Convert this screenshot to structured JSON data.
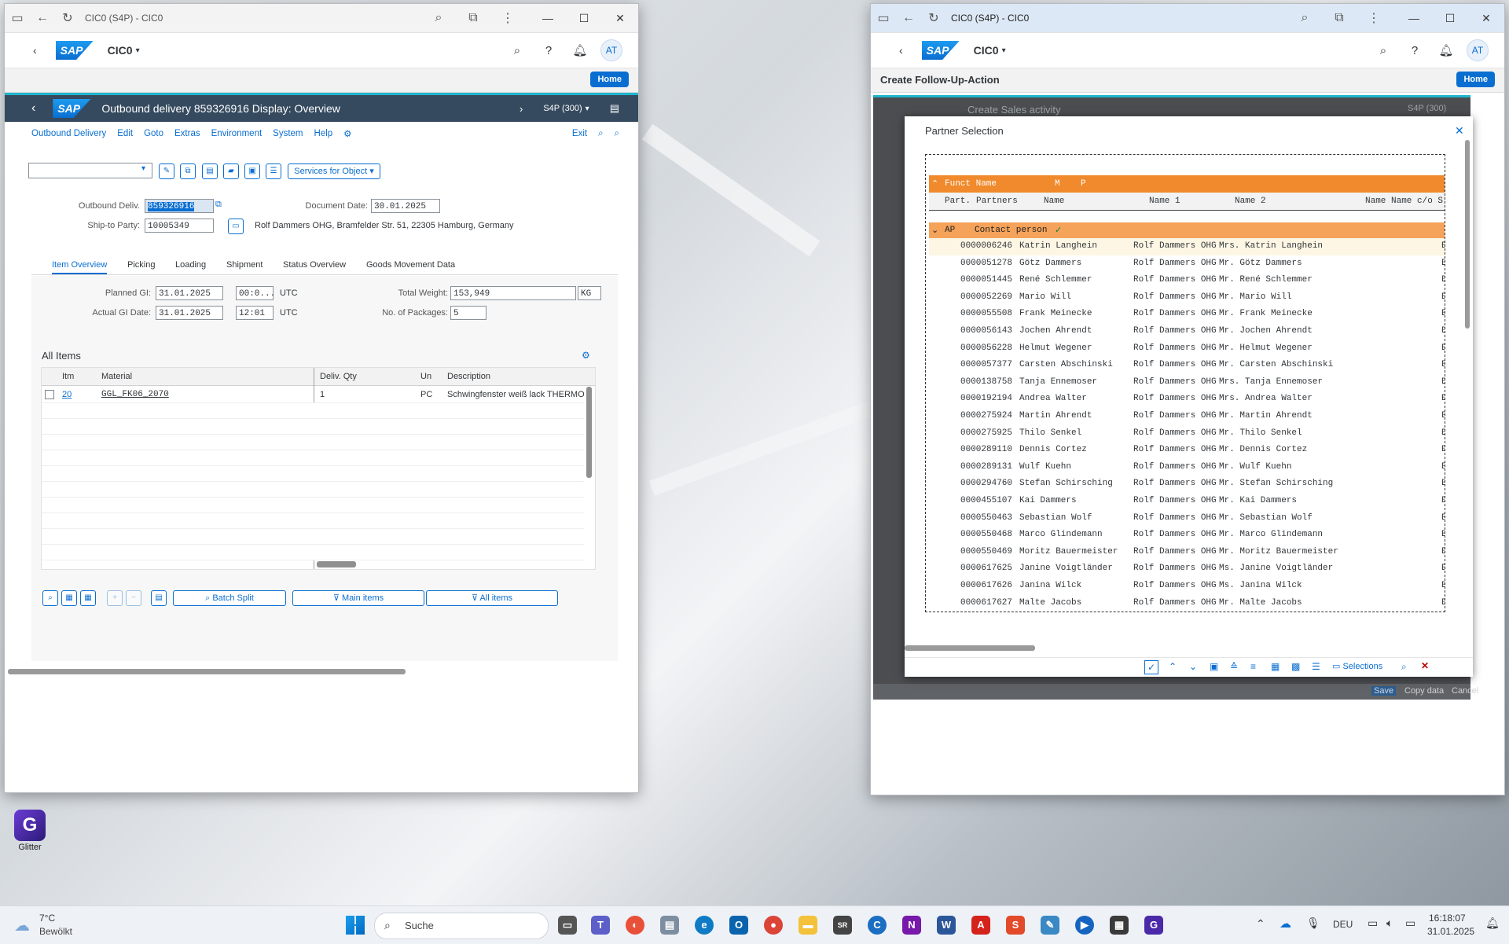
{
  "desktop": {
    "shortcut_label": "Glitter",
    "icons": {
      "shortcut": "glitter-app-icon"
    }
  },
  "left_window": {
    "browser_title": "CIC0 (S4P) - CIC0",
    "shell": {
      "app_name": "CIC0",
      "avatar_initials": "AT",
      "home_label": "Home"
    },
    "transaction_title": "Outbound delivery 859326916 Display: Overview",
    "system_label": "S4P (300)",
    "menu": [
      "Outbound Delivery",
      "Edit",
      "Goto",
      "Extras",
      "Environment",
      "System",
      "Help"
    ],
    "exit_label": "Exit",
    "services_label": "Services for Object",
    "header": {
      "outbound_label": "Outbound Deliv.",
      "outbound_value": "859326916",
      "docdate_label": "Document Date:",
      "docdate_value": "30.01.2025",
      "shipto_label": "Ship-to Party:",
      "shipto_value": "10005349",
      "shipto_address": "Rolf Dammers OHG, Bramfelder Str. 51, 22305 Hamburg, Germany"
    },
    "tabs": [
      "Item Overview",
      "Picking",
      "Loading",
      "Shipment",
      "Status Overview",
      "Goods Movement Data"
    ],
    "overview": {
      "planned_gi_label": "Planned GI:",
      "planned_gi_date": "31.01.2025",
      "planned_gi_time": "00:0...",
      "actual_gi_label": "Actual GI Date:",
      "actual_gi_date": "31.01.2025",
      "actual_gi_time": "12:01",
      "tz": "UTC",
      "total_weight_label": "Total Weight:",
      "total_weight_value": "153,949",
      "weight_unit": "KG",
      "packages_label": "No. of Packages:",
      "packages_value": "5"
    },
    "items_title": "All Items",
    "items_columns": [
      "Itm",
      "Material",
      "Deliv. Qty",
      "Un",
      "Description"
    ],
    "items_rows": [
      {
        "itm": "20",
        "material": "GGL_FK06_2070",
        "qty": "1",
        "unit": "PC",
        "description": "Schwingfenster weiß lack THERMO"
      }
    ],
    "bottom_buttons": {
      "batch_split": "Batch Split",
      "main_items": "Main items",
      "all_items": "All items"
    }
  },
  "right_window": {
    "browser_title": "CIC0 (S4P) - CIC0",
    "shell": {
      "app_name": "CIC0",
      "avatar_initials": "AT",
      "home_label": "Home"
    },
    "page_title": "Create Follow-Up-Action",
    "bg_transaction": "Create Sales activity",
    "bg_system": "S4P (300)",
    "bg_footer": {
      "save": "Save",
      "copy": "Copy data",
      "cancel": "Cancel"
    },
    "dialog": {
      "title": "Partner Selection",
      "group_header": {
        "funct": "Funct Name",
        "m": "M",
        "p": "P"
      },
      "columns": [
        "Part.",
        "Partners",
        "Name",
        "Name 1",
        "Name 2",
        "Name Name c/o S"
      ],
      "group_row": {
        "code": "AP",
        "label": "Contact person"
      },
      "rows": [
        {
          "partner": "0000006246",
          "name": "Katrin Langhein",
          "name1": "Rolf Dammers OHG",
          "name2": "Mrs. Katrin Langhein",
          "tail": "B"
        },
        {
          "partner": "0000051278",
          "name": "Götz Dammers",
          "name1": "Rolf Dammers OHG",
          "name2": "Mr. Götz Dammers",
          "tail": "B"
        },
        {
          "partner": "0000051445",
          "name": "René Schlemmer",
          "name1": "Rolf Dammers OHG",
          "name2": "Mr. René Schlemmer",
          "tail": "B"
        },
        {
          "partner": "0000052269",
          "name": "Mario Will",
          "name1": "Rolf Dammers OHG",
          "name2": "Mr. Mario Will",
          "tail": "B"
        },
        {
          "partner": "0000055508",
          "name": "Frank Meinecke",
          "name1": "Rolf Dammers OHG",
          "name2": "Mr. Frank Meinecke",
          "tail": "B"
        },
        {
          "partner": "0000056143",
          "name": "Jochen Ahrendt",
          "name1": "Rolf Dammers OHG",
          "name2": "Mr. Jochen Ahrendt",
          "tail": "B"
        },
        {
          "partner": "0000056228",
          "name": "Helmut Wegener",
          "name1": "Rolf Dammers OHG",
          "name2": "Mr. Helmut Wegener",
          "tail": "B"
        },
        {
          "partner": "0000057377",
          "name": "Carsten Abschinski",
          "name1": "Rolf Dammers OHG",
          "name2": "Mr. Carsten Abschinski",
          "tail": "B"
        },
        {
          "partner": "0000138758",
          "name": "Tanja Ennemoser",
          "name1": "Rolf Dammers OHG",
          "name2": "Mrs. Tanja Ennemoser",
          "tail": "B"
        },
        {
          "partner": "0000192194",
          "name": "Andrea Walter",
          "name1": "Rolf Dammers OHG",
          "name2": "Mrs. Andrea Walter",
          "tail": "B"
        },
        {
          "partner": "0000275924",
          "name": "Martin Ahrendt",
          "name1": "Rolf Dammers OHG",
          "name2": "Mr. Martin Ahrendt",
          "tail": "B"
        },
        {
          "partner": "0000275925",
          "name": "Thilo Senkel",
          "name1": "Rolf Dammers OHG",
          "name2": "Mr. Thilo Senkel",
          "tail": "B"
        },
        {
          "partner": "0000289110",
          "name": "Dennis Cortez",
          "name1": "Rolf Dammers OHG",
          "name2": "Mr. Dennis Cortez",
          "tail": "B"
        },
        {
          "partner": "0000289131",
          "name": "Wulf Kuehn",
          "name1": "Rolf Dammers OHG",
          "name2": "Mr. Wulf Kuehn",
          "tail": "B"
        },
        {
          "partner": "0000294760",
          "name": "Stefan Schirsching",
          "name1": "Rolf Dammers OHG",
          "name2": "Mr. Stefan Schirsching",
          "tail": "B"
        },
        {
          "partner": "0000455107",
          "name": "Kai Dammers",
          "name1": "Rolf Dammers OHG",
          "name2": "Mr. Kai Dammers",
          "tail": "B"
        },
        {
          "partner": "0000550463",
          "name": "Sebastian Wolf",
          "name1": "Rolf Dammers OHG",
          "name2": "Mr. Sebastian Wolf",
          "tail": "B"
        },
        {
          "partner": "0000550468",
          "name": "Marco Glindemann",
          "name1": "Rolf Dammers OHG",
          "name2": "Mr. Marco Glindemann",
          "tail": "B"
        },
        {
          "partner": "0000550469",
          "name": "Moritz Bauermeister",
          "name1": "Rolf Dammers OHG",
          "name2": "Mr. Moritz Bauermeister",
          "tail": "B"
        },
        {
          "partner": "0000617625",
          "name": "Janine Voigtländer",
          "name1": "Rolf Dammers OHG",
          "name2": "Ms. Janine Voigtländer",
          "tail": "B"
        },
        {
          "partner": "0000617626",
          "name": "Janina Wilck",
          "name1": "Rolf Dammers OHG",
          "name2": "Ms. Janina Wilck",
          "tail": "B"
        },
        {
          "partner": "0000617627",
          "name": "Malte Jacobs",
          "name1": "Rolf Dammers OHG",
          "name2": "Mr. Malte Jacobs",
          "tail": "B"
        }
      ],
      "footer_selections": "Selections"
    }
  },
  "taskbar": {
    "weather_temp": "7°C",
    "weather_desc": "Bewölkt",
    "search_placeholder": "Suche",
    "language": "DEU",
    "time": "16:18:07",
    "date": "31.01.2025"
  },
  "colors": {
    "sap_blue": "#0a6ed1",
    "sap_header": "#354a5f",
    "orange_header": "#f08a2c",
    "accent": "#21b5ce"
  }
}
